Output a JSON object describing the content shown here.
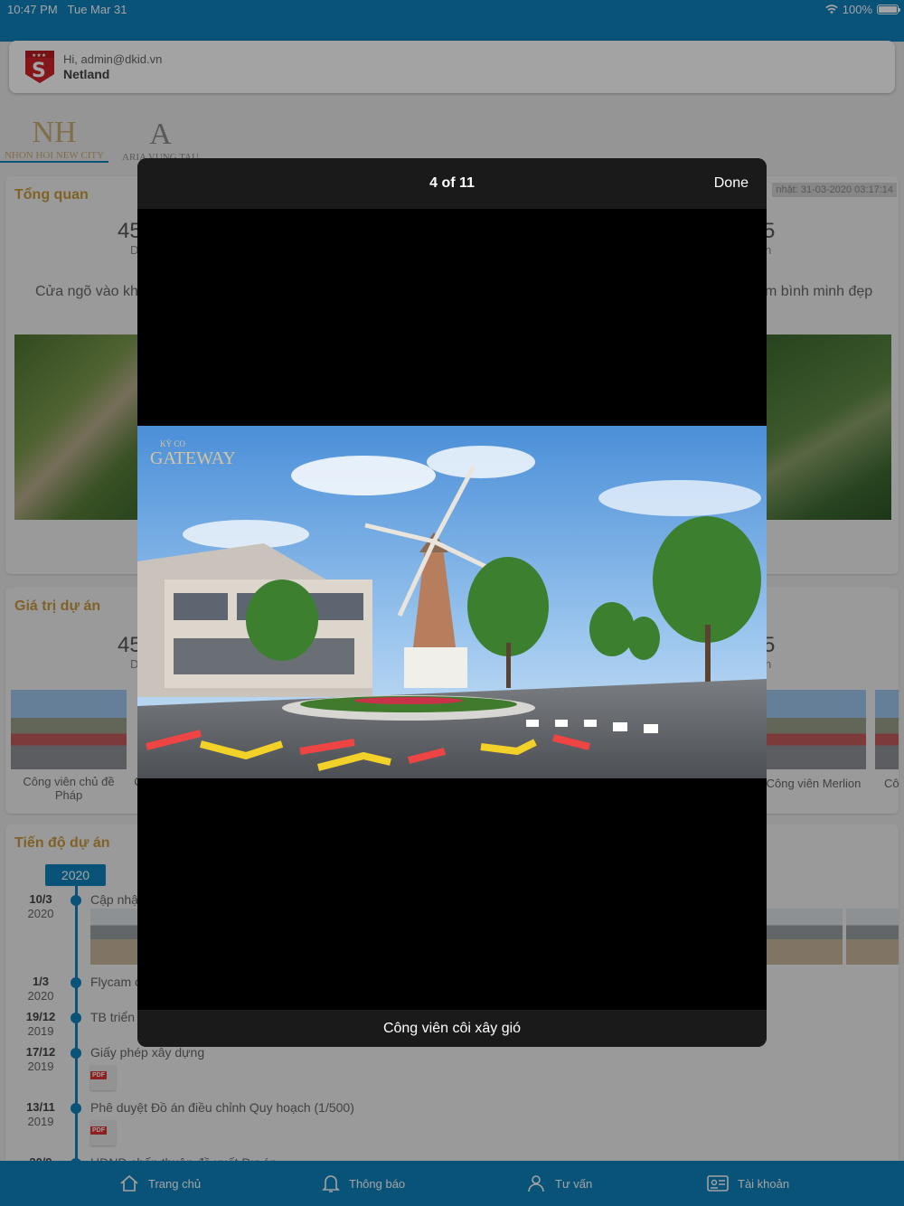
{
  "status": {
    "time": "10:47 PM",
    "date": "Tue Mar 31",
    "battery": "100%"
  },
  "header": {
    "greeting": "Hi, admin@dkid.vn",
    "company": "Netland"
  },
  "projects": [
    {
      "mark": "NH",
      "name": "NHON HOI NEW CITY"
    },
    {
      "mark": "A",
      "name": "ARIA VUNG TAU"
    }
  ],
  "overview": {
    "title": "Tổng quan",
    "updated": "nhật: 31-03-2020 03:17:14",
    "left_value": "45",
    "left_unit": "D",
    "right_value": "5",
    "right_unit": "n",
    "left_desc": "Cửa ngõ vào khu",
    "right_desc": "m bình minh đẹp"
  },
  "value": {
    "title": "Giá trị dự án",
    "left_value": "45",
    "left_unit": "D",
    "right_value": "5",
    "right_unit": "n",
    "left_caption": "Công viên chủ đề Pháp",
    "left_caption2": "C",
    "right_caption": "Công viên Merlion",
    "right_caption2": "Cô"
  },
  "progress": {
    "title": "Tiến độ dự án",
    "year": "2020",
    "events": [
      {
        "day": "10/3",
        "year": "2020",
        "title": "Cập nhậ"
      },
      {
        "day": "1/3",
        "year": "2020",
        "title": "Flycam c"
      },
      {
        "day": "19/12",
        "year": "2019",
        "title": "TB triển"
      },
      {
        "day": "17/12",
        "year": "2019",
        "title": "Giấy phép xây dựng"
      },
      {
        "day": "13/11",
        "year": "2019",
        "title": "Phê duyệt Đồ án điều chỉnh Quy hoạch (1/500)"
      },
      {
        "day": "20/9",
        "year": "",
        "title": "HĐND chấp thuận đề xuất Dự án"
      }
    ],
    "pdf_label": "PDF"
  },
  "gallery": {
    "counter": "4 of 11",
    "done": "Done",
    "caption": "Công viên côi xây gió",
    "brand_top": "KỲ CO",
    "brand": "GATEWAY"
  },
  "tabs": [
    {
      "label": "Trang chủ",
      "icon": "home-icon"
    },
    {
      "label": "Thông báo",
      "icon": "bell-icon"
    },
    {
      "label": "Tư vấn",
      "icon": "consult-icon"
    },
    {
      "label": "Tài khoản",
      "icon": "account-icon"
    }
  ]
}
